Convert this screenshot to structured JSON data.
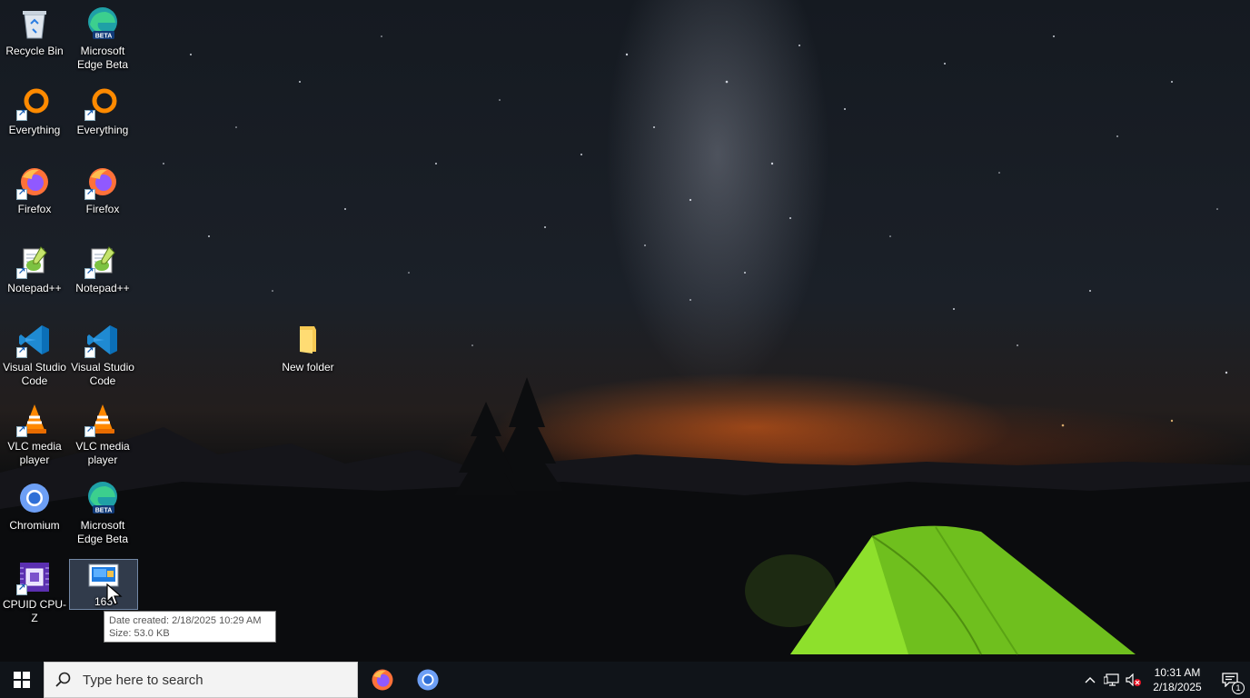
{
  "desktop": {
    "icons": [
      {
        "label": "Recycle Bin",
        "icon": "recycle-bin-icon"
      },
      {
        "label": "Microsoft Edge Beta",
        "icon": "edge-beta-icon"
      },
      {
        "label": "Everything",
        "icon": "everything-icon"
      },
      {
        "label": "Everything",
        "icon": "everything-icon"
      },
      {
        "label": "Firefox",
        "icon": "firefox-icon"
      },
      {
        "label": "Firefox",
        "icon": "firefox-icon"
      },
      {
        "label": "Notepad++",
        "icon": "notepadpp-icon"
      },
      {
        "label": "Notepad++",
        "icon": "notepadpp-icon"
      },
      {
        "label": "Visual Studio Code",
        "icon": "vscode-icon"
      },
      {
        "label": "Visual Studio Code",
        "icon": "vscode-icon"
      },
      {
        "label": "VLC media player",
        "icon": "vlc-icon"
      },
      {
        "label": "VLC media player",
        "icon": "vlc-icon"
      },
      {
        "label": "Chromium",
        "icon": "chromium-icon"
      },
      {
        "label": "Microsoft Edge Beta",
        "icon": "edge-beta-icon"
      },
      {
        "label": "CPUID CPU-Z",
        "icon": "cpuz-icon"
      },
      {
        "label": "165",
        "icon": "image-file-icon"
      },
      {
        "label": "New folder",
        "icon": "folder-icon"
      }
    ]
  },
  "tooltip": {
    "date_created": "Date created: 2/18/2025 10:29 AM",
    "size": "Size: 53.0 KB"
  },
  "taskbar": {
    "search_placeholder": "Type here to search",
    "pinned": [
      {
        "icon": "firefox-icon"
      },
      {
        "icon": "chromium-icon"
      }
    ],
    "clock": {
      "time": "10:31 AM",
      "date": "2/18/2025"
    },
    "notification_count": "1"
  },
  "colors": {
    "taskbar": "#101419",
    "selection": "#7896be",
    "tent_green": "#7ed321"
  }
}
